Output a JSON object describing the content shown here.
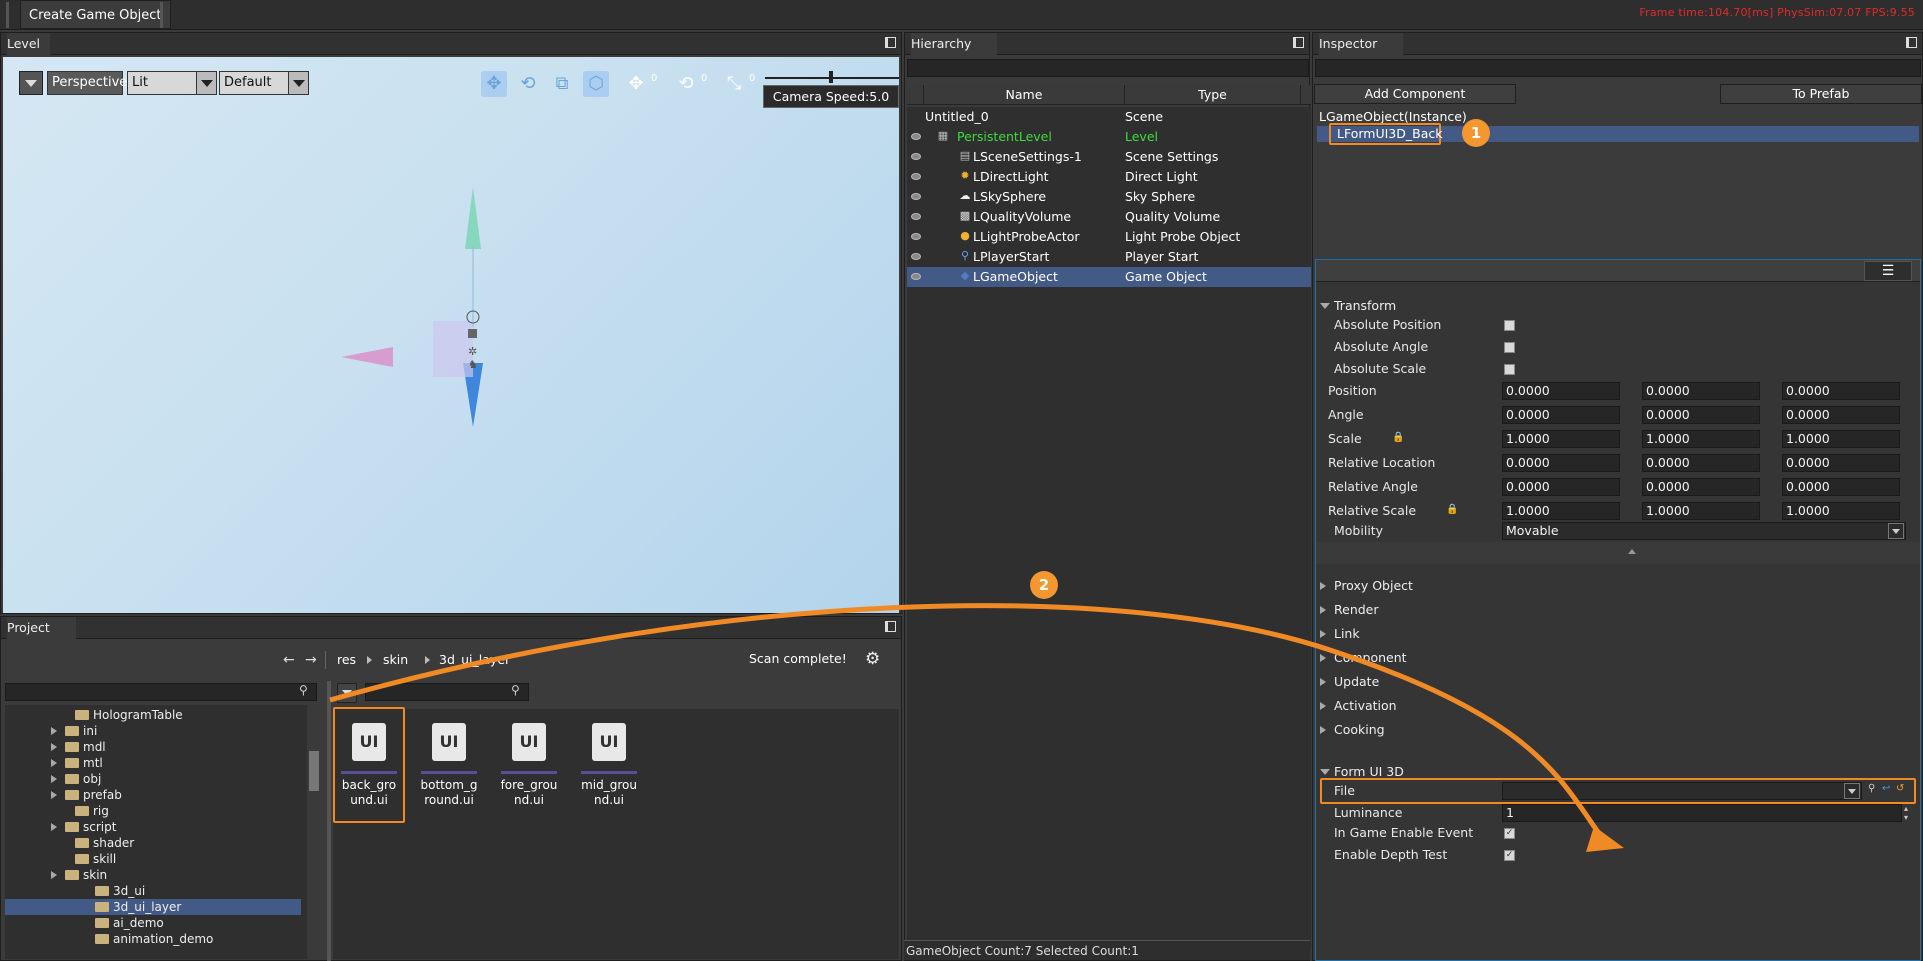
{
  "toolbar": {
    "create_label": "Create Game Object"
  },
  "stats": {
    "text": "Frame time:104.70[ms]   PhysSim:07.07   FPS:9.55"
  },
  "level": {
    "title": "Level",
    "view_mode": "Perspective",
    "shading": "Lit",
    "preset": "Default",
    "counters": [
      "0",
      "0",
      "0"
    ],
    "camera_speed": "Camera Speed:5.0"
  },
  "project": {
    "title": "Project",
    "breadcrumb": [
      "res",
      "skin",
      "3d_ui_layer"
    ],
    "status": "Scan complete!",
    "tree": [
      {
        "label": "HologramTable",
        "arrow": false
      },
      {
        "label": "ini",
        "arrow": true
      },
      {
        "label": "mdl",
        "arrow": true
      },
      {
        "label": "mtl",
        "arrow": true
      },
      {
        "label": "obj",
        "arrow": true
      },
      {
        "label": "prefab",
        "arrow": true
      },
      {
        "label": "rig",
        "arrow": false
      },
      {
        "label": "script",
        "arrow": true
      },
      {
        "label": "shader",
        "arrow": false
      },
      {
        "label": "skill",
        "arrow": false
      },
      {
        "label": "skin",
        "arrow": true
      },
      {
        "label": "3d_ui",
        "arrow": false
      },
      {
        "label": "3d_ui_layer",
        "arrow": false
      },
      {
        "label": "ai_demo",
        "arrow": false
      },
      {
        "label": "animation_demo",
        "arrow": false
      }
    ],
    "files": [
      {
        "icon": "UI",
        "name": "back_gro und.ui"
      },
      {
        "icon": "UI",
        "name": "bottom_g round.ui"
      },
      {
        "icon": "UI",
        "name": "fore_grou nd.ui"
      },
      {
        "icon": "UI",
        "name": "mid_grou nd.ui"
      }
    ]
  },
  "hierarchy": {
    "title": "Hierarchy",
    "col_name": "Name",
    "col_type": "Type",
    "rows": [
      {
        "name": "Untitled_0",
        "type": "Scene",
        "icon": ""
      },
      {
        "name": "PersistentLevel",
        "type": "Level",
        "icon": "level"
      },
      {
        "name": "LSceneSettings-1",
        "type": "Scene Settings",
        "icon": "doc"
      },
      {
        "name": "LDirectLight",
        "type": "Direct Light",
        "icon": "sun"
      },
      {
        "name": "LSkySphere",
        "type": "Sky Sphere",
        "icon": "cloud"
      },
      {
        "name": "LQualityVolume",
        "type": "Quality Volume",
        "icon": "grid"
      },
      {
        "name": "LLightProbeActor",
        "type": "Light Probe Object",
        "icon": "bulb"
      },
      {
        "name": "LPlayerStart",
        "type": "Player Start",
        "icon": "pin"
      },
      {
        "name": "LGameObject",
        "type": "Game Object",
        "icon": "obj"
      }
    ],
    "footer": "GameObject Count:7    Selected Count:1"
  },
  "inspector": {
    "title": "Inspector",
    "add_component": "Add Component",
    "to_prefab": "To Prefab",
    "instance_label": "LGameObject(Instance)",
    "component": "LFormUI3D_Back",
    "transform_title": "Transform",
    "abs_position": "Absolute Position",
    "abs_angle": "Absolute Angle",
    "abs_scale": "Absolute Scale",
    "rows": [
      {
        "label": "Position",
        "v": [
          "0.0000",
          "0.0000",
          "0.0000"
        ]
      },
      {
        "label": "Angle",
        "v": [
          "0.0000",
          "0.0000",
          "0.0000"
        ]
      },
      {
        "label": "Scale",
        "v": [
          "1.0000",
          "1.0000",
          "1.0000"
        ]
      },
      {
        "label": "Relative Location",
        "v": [
          "0.0000",
          "0.0000",
          "0.0000"
        ]
      },
      {
        "label": "Relative Angle",
        "v": [
          "0.0000",
          "0.0000",
          "0.0000"
        ]
      },
      {
        "label": "Relative Scale",
        "v": [
          "1.0000",
          "1.0000",
          "1.0000"
        ]
      }
    ],
    "mobility_label": "Mobility",
    "mobility_value": "Movable",
    "sections": [
      "Proxy Object",
      "Render",
      "Link",
      "Component",
      "Update",
      "Activation",
      "Cooking"
    ],
    "form_title": "Form UI 3D",
    "file_label": "File",
    "luminance_label": "Luminance",
    "luminance_value": "1",
    "in_game_event": "In Game Enable Event",
    "depth_test": "Enable Depth Test"
  },
  "annotations": {
    "badge1": "1",
    "badge2": "2"
  },
  "colors": {
    "accent": "#f08a24",
    "selection": "#445a86",
    "level_green": "#3ddc3d"
  }
}
